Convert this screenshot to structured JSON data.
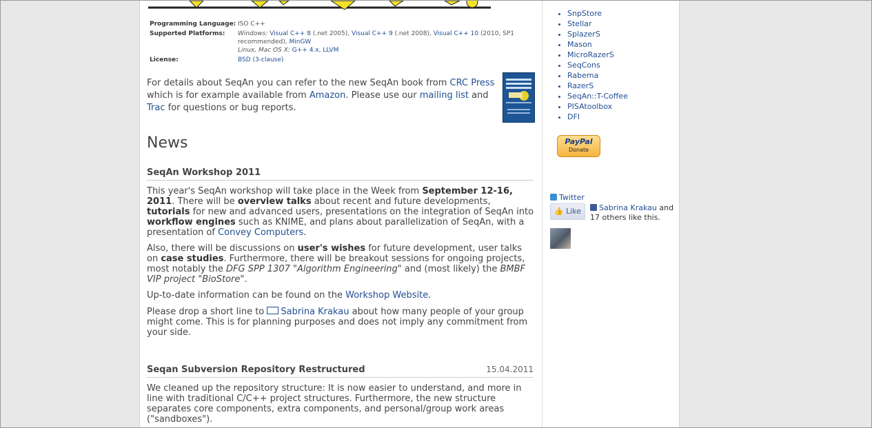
{
  "info": {
    "language_label": "Programming Language:",
    "language_value": "ISO C++",
    "platforms_label": "Supported Platforms:",
    "windows_prefix": "Windows:",
    "vc8": "Visual C++ 8",
    "vc8_note": "(.net 2005),",
    "vc9": "Visual C++ 9",
    "vc9_note": "(.net 2008),",
    "vc10": "Visual C++ 10",
    "vc10_note": "(2010, SP1 recommended),",
    "mingw": "MinGW",
    "unix_prefix": "Linux, Mac OS X:",
    "gcc": "G++ 4.x",
    "comma": ",",
    "llvm": "LLVM",
    "license_label": "License:",
    "license_value": "BSD (3-clause)"
  },
  "book": {
    "t1": "For details about SeqAn you can refer to the new SeqAn book from ",
    "crc": "CRC Press",
    "t2": " which is for example available from ",
    "amazon": "Amazon",
    "t3": ". Please use our ",
    "mailing": "mailing list",
    "t4": " and ",
    "trac": "Trac",
    "t5": " for questions or bug reports."
  },
  "news_heading": "News",
  "workshop": {
    "title": "SeqAn Workshop 2011",
    "p1_a": "This year's SeqAn workshop will take place in the Week from ",
    "p1_dates": "September 12-16, 2011",
    "p1_b": ". There will be ",
    "p1_overview": "overview talks",
    "p1_c": " about recent and future developments, ",
    "p1_tutorials": "tutorials",
    "p1_d": " for new and advanced users, presentations on the integration of SeqAn into ",
    "p1_workflow": "workflow engines",
    "p1_e": " such as KNIME, and plans about parallelization of SeqAn, with a presentation of ",
    "p1_convey": "Convey Computers",
    "p1_f": ".",
    "p2_a": "Also, there will be discussions on ",
    "p2_wishes": "user's wishes",
    "p2_b": " for future development, user talks on ",
    "p2_case": "case studies",
    "p2_c": ". Furthermore, there will be breakout sessions for ongoing projects, most notably the ",
    "p2_dfg": "DFG SPP 1307 \"Algorithm Engineering\"",
    "p2_d": " and (most likely) the ",
    "p2_bmbf": "BMBF VIP project \"BioStore\"",
    "p2_e": ".",
    "p3_a": "Up-to-date information can be found on the ",
    "p3_link": "Workshop Website",
    "p3_b": ".",
    "p4_a": "Please drop a short line to ",
    "p4_name": "Sabrina Krakau",
    "p4_b": " about how many people of your group might come. This is for planning purposes and does not imply any commitment from your side."
  },
  "repo": {
    "title": "Seqan Subversion Repository Restructured",
    "date": "15.04.2011",
    "p1": "We cleaned up the repository structure: It is now easier to understand, and more in line with traditional C/C++ project structures. Furthermore, the new structure separates core components, extra components, and personal/group work areas (\"sandboxes\")."
  },
  "sidebar": {
    "items": [
      "SnpStore",
      "Stellar",
      "SplazerS",
      "Mason",
      "MicroRazerS",
      "SeqCons",
      "Rabema",
      "RazerS",
      "SeqAn::T-Coffee",
      "PISAtoolbox",
      "DFI"
    ],
    "paypal_text": "PayPal",
    "paypal_donate": "Donate",
    "twitter": "Twitter",
    "like": "Like",
    "fb_name": "Sabrina Krakau",
    "fb_and": " and",
    "fb_others": "17 others like this."
  }
}
